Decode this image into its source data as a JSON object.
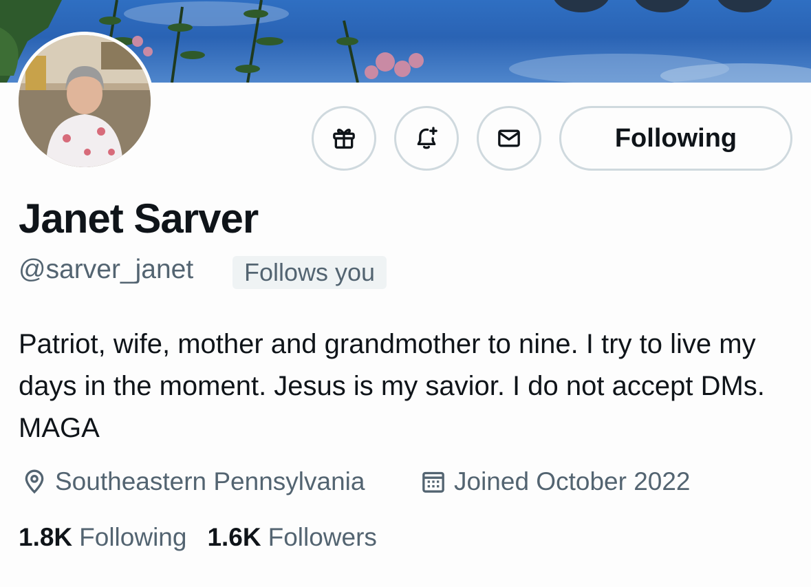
{
  "profile": {
    "name": "Janet Sarver",
    "handle": "@sarver_janet",
    "follows_you": "Follows you",
    "bio": "Patriot, wife, mother and grandmother to nine. I try to live my days in the moment. Jesus is my savior. I do not accept DMs. MAGA",
    "location": "Southeastern Pennsylvania",
    "joined": "Joined October 2022",
    "following_count": "1.8K",
    "following_label": "Following",
    "followers_count": "1.6K",
    "followers_label": "Followers"
  },
  "actions": {
    "gift_icon": "gift-icon",
    "notify_icon": "bell-plus-icon",
    "message_icon": "envelope-icon",
    "follow_label": "Following"
  },
  "colors": {
    "text_primary": "#0f1419",
    "text_secondary": "#536471",
    "border": "#cfd9de",
    "badge_bg": "#eff3f4"
  }
}
